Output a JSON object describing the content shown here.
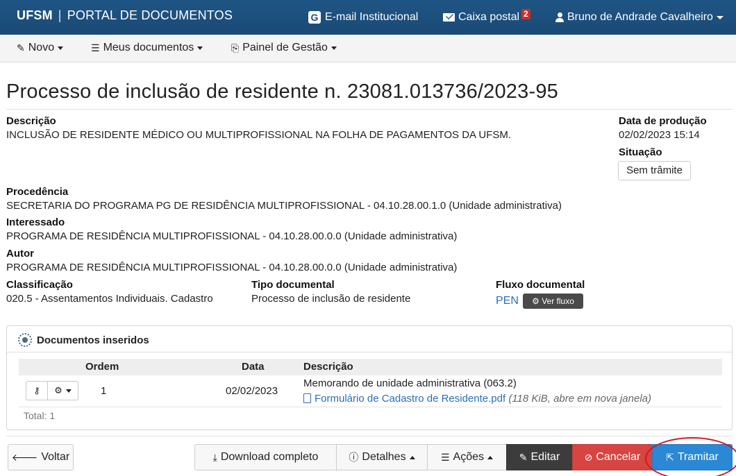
{
  "topbar": {
    "brand_bold": "UFSM",
    "brand_sep": "|",
    "brand_text": "PORTAL DE DOCUMENTOS",
    "email_label": "E-mail Institucional",
    "mailbox_label": "Caixa postal",
    "mailbox_count": "2",
    "user_name": "Bruno de Andrade Cavalheiro"
  },
  "subnav": {
    "novo": "Novo",
    "meus_documentos": "Meus documentos",
    "painel_gestao": "Painel de Gestão"
  },
  "process": {
    "title": "Processo de inclusão de residente n. 23081.013736/2023-95",
    "descricao_label": "Descrição",
    "descricao": "INCLUSÃO DE RESIDENTE MÉDICO OU MULTIPROFISSIONAL NA FOLHA DE PAGAMENTOS DA UFSM.",
    "data_producao_label": "Data de produção",
    "data_producao": "02/02/2023 15:14",
    "situacao_label": "Situação",
    "situacao": "Sem trâmite",
    "procedencia_label": "Procedência",
    "procedencia": "SECRETARIA DO PROGRAMA PG DE RESIDÊNCIA MULTIPROFISSIONAL - 04.10.28.00.1.0 (Unidade administrativa)",
    "interessado_label": "Interessado",
    "interessado": "PROGRAMA DE RESIDÊNCIA MULTIPROFISSIONAL - 04.10.28.00.0.0 (Unidade administrativa)",
    "autor_label": "Autor",
    "autor": "PROGRAMA DE RESIDÊNCIA MULTIPROFISSIONAL - 04.10.28.00.0.0 (Unidade administrativa)",
    "classificacao_label": "Classificação",
    "classificacao": "020.5 - Assentamentos Individuais. Cadastro",
    "tipo_label": "Tipo documental",
    "tipo": "Processo de inclusão de residente",
    "fluxo_label": "Fluxo documental",
    "fluxo_link": "PEN",
    "fluxo_button": "Ver fluxo"
  },
  "documents": {
    "panel_title": "Documentos inseridos",
    "columns": {
      "ordem": "Ordem",
      "data": "Data",
      "descricao": "Descrição"
    },
    "rows": [
      {
        "ordem": "1",
        "data": "02/02/2023",
        "descricao": "Memorando de unidade administrativa (063.2)",
        "file_name": "Formulário de Cadastro de Residente.pdf",
        "file_meta": "(118 KiB, abre em nova janela)"
      }
    ],
    "total": "Total: 1"
  },
  "actions": {
    "voltar": "Voltar",
    "download": "Download completo",
    "detalhes": "Detalhes",
    "acoes": "Ações",
    "editar": "Editar",
    "cancelar": "Cancelar",
    "tramitar": "Tramitar"
  },
  "colors": {
    "topbar": "#1d4f7d",
    "link": "#2a6ebb",
    "cancel": "#d64541",
    "tramitar": "#2a88d4",
    "highlight": "#d4171d"
  }
}
